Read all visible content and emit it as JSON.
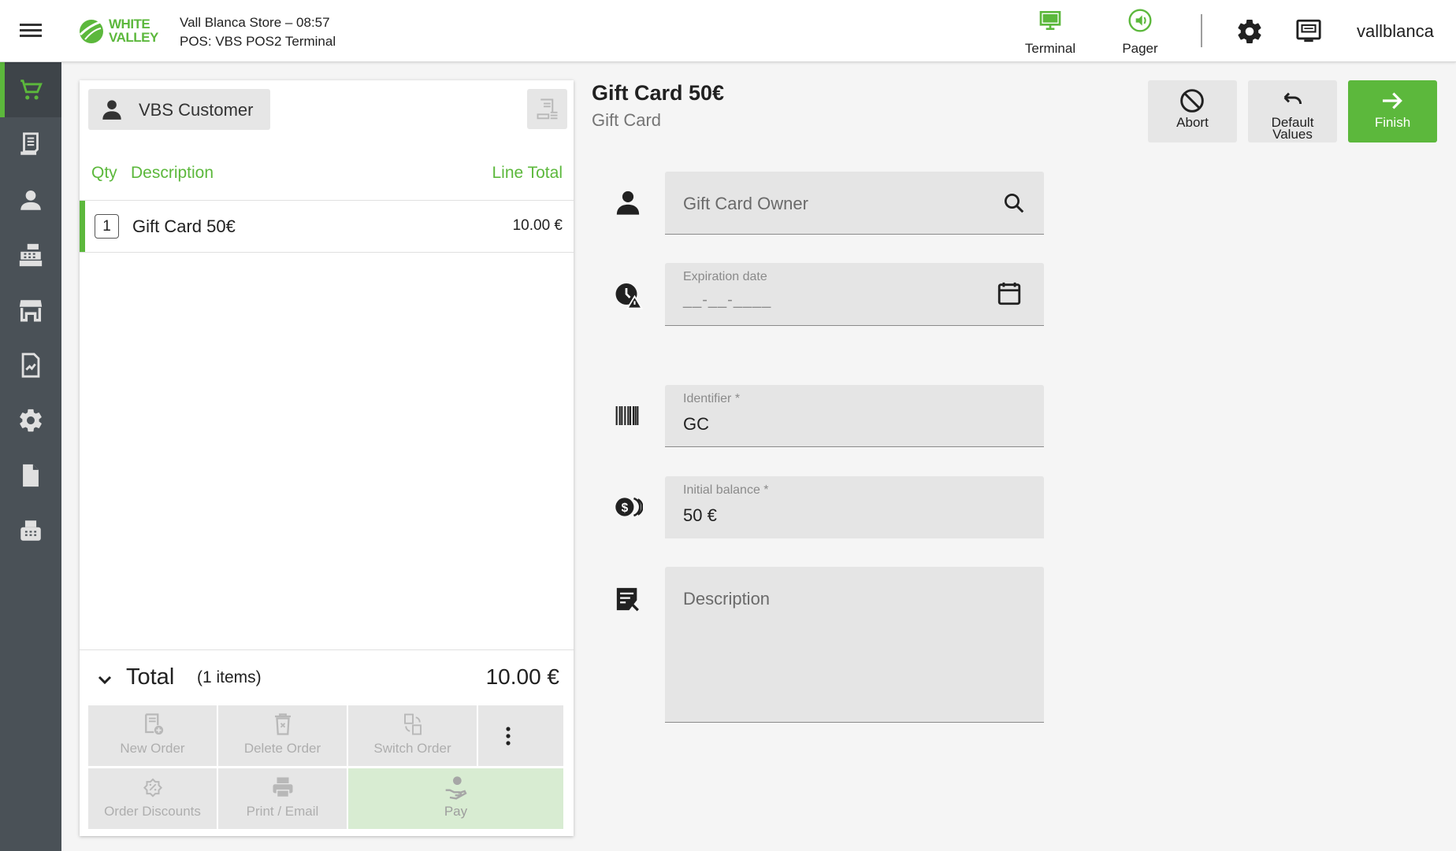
{
  "header": {
    "logo_text_line1": "WHITE",
    "logo_text_line2": "VALLEY",
    "store_line": "Vall Blanca Store – 08:57",
    "terminal_line": "POS: VBS POS2 Terminal",
    "nav": [
      {
        "label": "Terminal",
        "icon": "monitor-icon"
      },
      {
        "label": "Pager",
        "icon": "pager-icon"
      }
    ],
    "username": "vallblanca"
  },
  "sidebar": {
    "items": [
      {
        "name": "cart",
        "icon": "cart-icon",
        "active": true
      },
      {
        "name": "receipts",
        "icon": "receipt-icon"
      },
      {
        "name": "customers",
        "icon": "person-icon"
      },
      {
        "name": "cash-register",
        "icon": "cash-register-icon"
      },
      {
        "name": "store",
        "icon": "store-icon"
      },
      {
        "name": "reports",
        "icon": "report-icon"
      },
      {
        "name": "settings",
        "icon": "gear-icon"
      },
      {
        "name": "documents",
        "icon": "document-icon"
      },
      {
        "name": "fax",
        "icon": "fax-icon"
      }
    ]
  },
  "order": {
    "customer_label": "VBS Customer",
    "columns": {
      "qty": "Qty",
      "description": "Description",
      "line_total": "Line Total"
    },
    "lines": [
      {
        "qty": "1",
        "description": "Gift Card 50€",
        "total": "10.00 €"
      }
    ],
    "total_label": "Total",
    "items_label": "(1 items)",
    "total_value": "10.00 €",
    "actions": {
      "new_order": "New Order",
      "delete_order": "Delete Order",
      "switch_order": "Switch Order",
      "order_discounts": "Order Discounts",
      "print_email": "Print / Email",
      "pay": "Pay"
    }
  },
  "product": {
    "title": "Gift Card 50€",
    "subtitle": "Gift Card",
    "actions": {
      "abort": "Abort",
      "default_values_1": "Default",
      "default_values_2": "Values",
      "finish": "Finish"
    }
  },
  "form": {
    "owner_placeholder": "Gift Card Owner",
    "expiration_label": "Expiration date",
    "expiration_mask": "__-__-____",
    "identifier_label": "Identifier *",
    "identifier_value": "GC",
    "balance_label": "Initial balance *",
    "balance_value": "50 €",
    "description_placeholder": "Description"
  },
  "colors": {
    "accent": "#5cb83c",
    "sidebar": "#4a5157",
    "background": "#f5f5f5"
  }
}
